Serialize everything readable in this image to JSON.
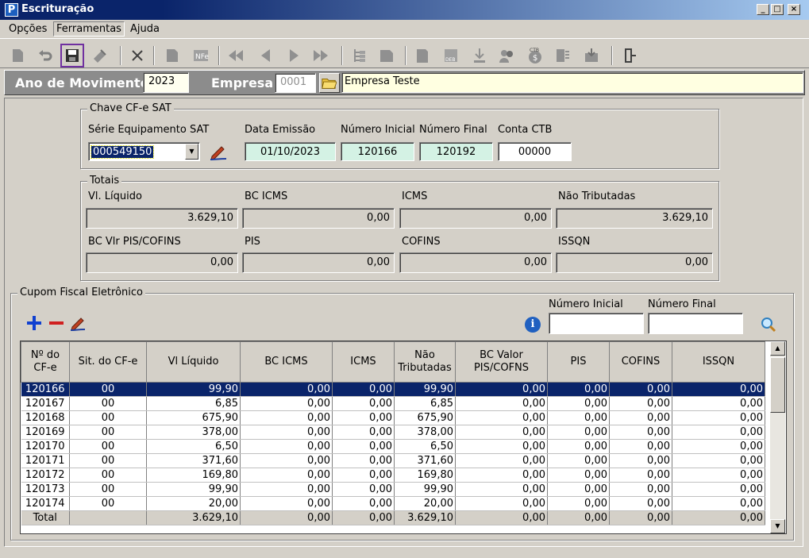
{
  "window": {
    "title": "Escrituração",
    "app_icon": "P"
  },
  "menu": [
    "Opções",
    "Ferramentas",
    "Ajuda"
  ],
  "header": {
    "ano_label": "Ano de Movimento",
    "ano_value": "2023",
    "empresa_label": "Empresa",
    "empresa_code": "0001",
    "empresa_name": "Empresa Teste"
  },
  "chave": {
    "legend": "Chave CF-e SAT",
    "serie_label": "Série Equipamento SAT",
    "serie_value": "000549150",
    "data_label": "Data Emissão",
    "data_value": "01/10/2023",
    "ni_label": "Número Inicial",
    "ni_value": "120166",
    "nf_label": "Número Final",
    "nf_value": "120192",
    "ctb_label": "Conta CTB",
    "ctb_value": "00000"
  },
  "totais": {
    "legend": "Totais",
    "vl_liquido_label": "Vl. Líquido",
    "vl_liquido": "3.629,10",
    "bc_icms_label": "BC ICMS",
    "bc_icms": "0,00",
    "icms_label": "ICMS",
    "icms": "0,00",
    "nao_trib_label": "Não Tributadas",
    "nao_trib": "3.629,10",
    "bc_pis_label": "BC Vlr PIS/COFINS",
    "bc_pis": "0,00",
    "pis_label": "PIS",
    "pis": "0,00",
    "cofins_label": "COFINS",
    "cofins": "0,00",
    "issqn_label": "ISSQN",
    "issqn": "0,00"
  },
  "cupom": {
    "legend": "Cupom Fiscal Eletrônico",
    "ni_label": "Número Inicial",
    "nf_label": "Número Final",
    "columns": [
      "Nº do CF-e",
      "Sit. do CF-e",
      "Vl Líquido",
      "BC ICMS",
      "ICMS",
      "Não Tributadas",
      "BC Valor PIS/COFNS",
      "PIS",
      "COFINS",
      "ISSQN"
    ],
    "rows": [
      [
        "120166",
        "00",
        "99,90",
        "0,00",
        "0,00",
        "99,90",
        "0,00",
        "0,00",
        "0,00",
        "0,00"
      ],
      [
        "120167",
        "00",
        "6,85",
        "0,00",
        "0,00",
        "6,85",
        "0,00",
        "0,00",
        "0,00",
        "0,00"
      ],
      [
        "120168",
        "00",
        "675,90",
        "0,00",
        "0,00",
        "675,90",
        "0,00",
        "0,00",
        "0,00",
        "0,00"
      ],
      [
        "120169",
        "00",
        "378,00",
        "0,00",
        "0,00",
        "378,00",
        "0,00",
        "0,00",
        "0,00",
        "0,00"
      ],
      [
        "120170",
        "00",
        "6,50",
        "0,00",
        "0,00",
        "6,50",
        "0,00",
        "0,00",
        "0,00",
        "0,00"
      ],
      [
        "120171",
        "00",
        "371,60",
        "0,00",
        "0,00",
        "371,60",
        "0,00",
        "0,00",
        "0,00",
        "0,00"
      ],
      [
        "120172",
        "00",
        "169,80",
        "0,00",
        "0,00",
        "169,80",
        "0,00",
        "0,00",
        "0,00",
        "0,00"
      ],
      [
        "120173",
        "00",
        "99,90",
        "0,00",
        "0,00",
        "99,90",
        "0,00",
        "0,00",
        "0,00",
        "0,00"
      ],
      [
        "120174",
        "00",
        "20,00",
        "0,00",
        "0,00",
        "20,00",
        "0,00",
        "0,00",
        "0,00",
        "0,00"
      ]
    ],
    "total": [
      "Total",
      "",
      "3.629,10",
      "0,00",
      "0,00",
      "3.629,10",
      "0,00",
      "0,00",
      "0,00",
      "0,00"
    ]
  },
  "colors": {
    "selection": "#0a246a",
    "mint": "#d4f2e4",
    "highlight_border": "#7030a0",
    "empresa_bg": "#ffffe1"
  }
}
